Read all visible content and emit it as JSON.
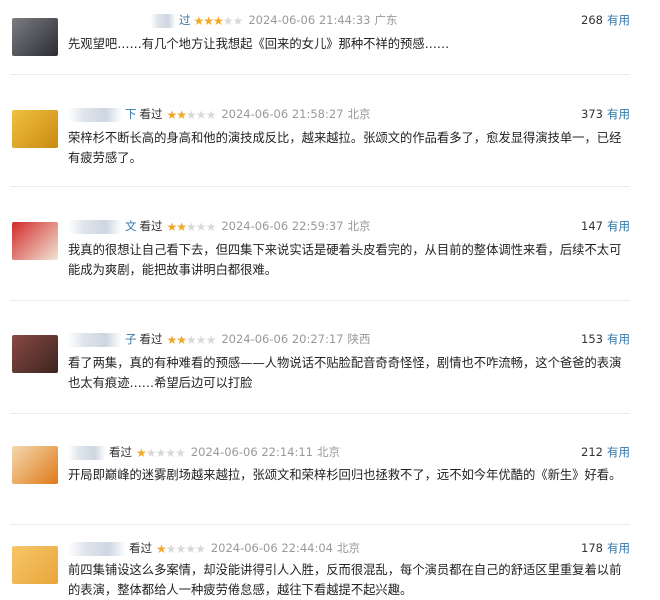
{
  "reviews": [
    {
      "name_tail": "过",
      "seen_label": "",
      "stars": 3,
      "time": "2024-06-06 21:44:33",
      "location": "广东",
      "votes": "268",
      "useful_label": "有用",
      "content": "先观望吧……有几个地方让我想起《回来的女儿》那种不祥的预感……",
      "avatar_colors": [
        "#7b7d82",
        "#2b2d33"
      ]
    },
    {
      "name_tail": "下",
      "seen_label": "看过",
      "stars": 2,
      "time": "2024-06-06 21:58:27",
      "location": "北京",
      "votes": "373",
      "useful_label": "有用",
      "content": "荣梓杉不断长高的身高和他的演技成反比，越来越拉。张颂文的作品看多了，愈发显得演技单一，已经有疲劳感了。",
      "avatar_colors": [
        "#f0c040",
        "#c98a12"
      ]
    },
    {
      "name_tail": "文",
      "seen_label": "看过",
      "stars": 2,
      "time": "2024-06-06 22:59:37",
      "location": "北京",
      "votes": "147",
      "useful_label": "有用",
      "content": "我真的很想让自己看下去，但四集下来说实话是硬着头皮看完的，从目前的整体调性来看，后续不太可能成为爽剧，能把故事讲明白都很难。",
      "avatar_colors": [
        "#d22a2a",
        "#f1e6d6"
      ]
    },
    {
      "name_tail": "子",
      "seen_label": "看过",
      "stars": 2,
      "time": "2024-06-06 20:27:17",
      "location": "陕西",
      "votes": "153",
      "useful_label": "有用",
      "content": "看了两集，真的有种难看的预感——人物说话不贴脸配音奇奇怪怪，剧情也不咋流畅，这个爸爸的表演也太有痕迹……希望后边可以打脸",
      "avatar_colors": [
        "#8a4a42",
        "#3b2420"
      ]
    },
    {
      "name_tail": "",
      "seen_label": "看过",
      "stars": 1,
      "time": "2024-06-06 22:14:11",
      "location": "北京",
      "votes": "212",
      "useful_label": "有用",
      "content": "开局即巅峰的迷雾剧场越来越拉，张颂文和荣梓杉回归也拯救不了，远不如今年优酷的《新生》好看。",
      "avatar_colors": [
        "#f3d8b0",
        "#e07a18"
      ]
    },
    {
      "name_tail": "",
      "seen_label": "看过",
      "stars": 1,
      "time": "2024-06-06 22:44:04",
      "location": "北京",
      "votes": "178",
      "useful_label": "有用",
      "content": "前四集铺设这么多案情，却没能讲得引人入胜，反而很混乱，每个演员都在自己的舒适区里重复着以前的表演，整体都给人一种疲劳倦怠感，越往下看越提不起兴趣。",
      "avatar_colors": [
        "#f6c66a",
        "#e9a63a"
      ]
    }
  ]
}
